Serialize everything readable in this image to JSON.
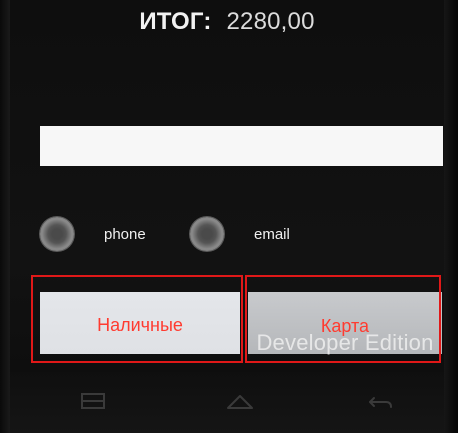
{
  "header": {
    "total_label": "ИТОГ:",
    "total_value": "2280,00"
  },
  "contact": {
    "value": "",
    "placeholder": ""
  },
  "contact_type": {
    "options": [
      {
        "label": "phone",
        "selected": false
      },
      {
        "label": "email",
        "selected": false
      }
    ]
  },
  "payment": {
    "cash_label": "Наличные",
    "card_label": "Карта",
    "button_text_color": "#ff3b30",
    "highlight_color": "#e01818"
  },
  "watermark": {
    "text": "Developer Edition"
  },
  "nav": {
    "icons": [
      "recent-apps-icon",
      "home-icon",
      "back-icon"
    ]
  }
}
